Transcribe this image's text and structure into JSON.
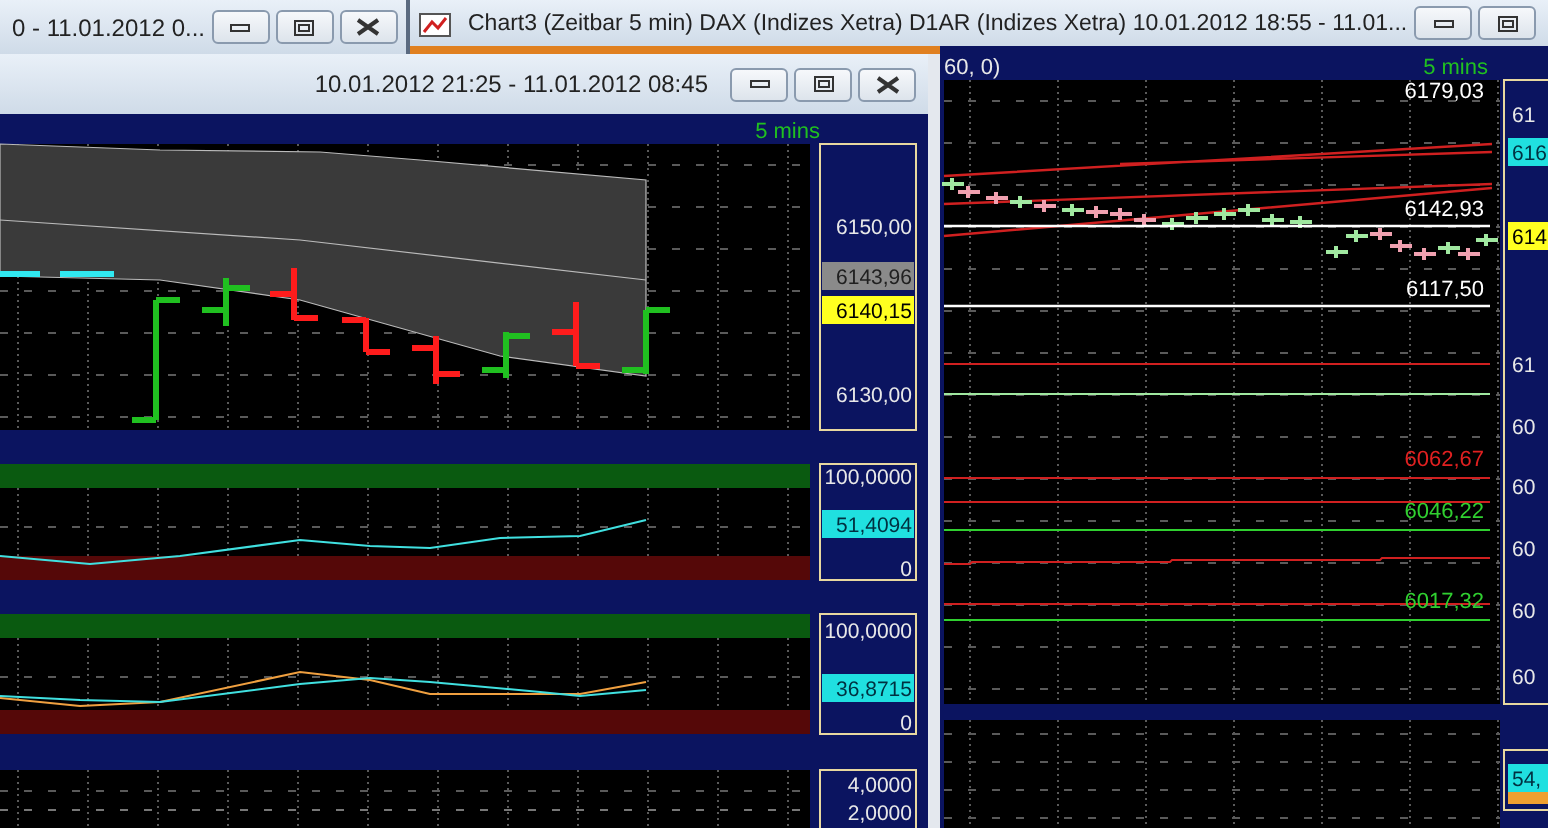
{
  "back_window": {
    "title": "0 - 11.01.2012 0..."
  },
  "chart_window": {
    "title": "Chart3 (Zeitbar 5 min)  DAX (Indizes Xetra) D1AR (Indizes Xetra) 10.01.2012 18:55 - 11.01...",
    "header": "60, 0)",
    "timeframe": "5 mins",
    "level_labels": [
      {
        "text": "6179,03",
        "color": "#ffffff"
      },
      {
        "text": "6142,93",
        "color": "#ffffff"
      },
      {
        "text": "6117,50",
        "color": "#ffffff"
      },
      {
        "text": "6062,67",
        "color": "#e02020"
      },
      {
        "text": "6046,22",
        "color": "#30d030"
      },
      {
        "text": "6017,32",
        "color": "#30d030"
      }
    ],
    "axis_labels": [
      {
        "text": "61",
        "kind": "tick"
      },
      {
        "text": "616",
        "kind": "indicator"
      },
      {
        "text": "614",
        "kind": "current"
      },
      {
        "text": "61",
        "kind": "tick"
      },
      {
        "text": "60",
        "kind": "tick"
      },
      {
        "text": "60",
        "kind": "tick"
      },
      {
        "text": "60",
        "kind": "tick"
      },
      {
        "text": "60",
        "kind": "tick"
      },
      {
        "text": "60",
        "kind": "tick"
      }
    ],
    "lower_axis_labels": [
      {
        "text": "54,",
        "kind": "indicator"
      }
    ]
  },
  "front_window": {
    "title": "10.01.2012 21:25 - 11.01.2012 08:45",
    "timeframe": "5 mins",
    "panes": [
      {
        "kind": "price",
        "axis_labels": [
          {
            "text": "6150,00",
            "kind": "tick"
          },
          {
            "text": "6143,96",
            "kind": "last"
          },
          {
            "text": "6140,15",
            "kind": "current"
          },
          {
            "text": "6130,00",
            "kind": "tick"
          }
        ]
      },
      {
        "kind": "oscillator",
        "axis_labels": [
          {
            "text": "100,0000",
            "kind": "tick"
          },
          {
            "text": "51,4094",
            "kind": "indicator"
          },
          {
            "text": "0",
            "kind": "tick"
          }
        ]
      },
      {
        "kind": "stochastic",
        "axis_labels": [
          {
            "text": "100,0000",
            "kind": "tick"
          },
          {
            "text": "36,8715",
            "kind": "indicator"
          },
          {
            "text": "0",
            "kind": "tick"
          }
        ]
      },
      {
        "kind": "volume",
        "axis_labels": [
          {
            "text": "4,0000",
            "kind": "tick"
          },
          {
            "text": "2,0000",
            "kind": "tick"
          }
        ]
      }
    ]
  }
}
